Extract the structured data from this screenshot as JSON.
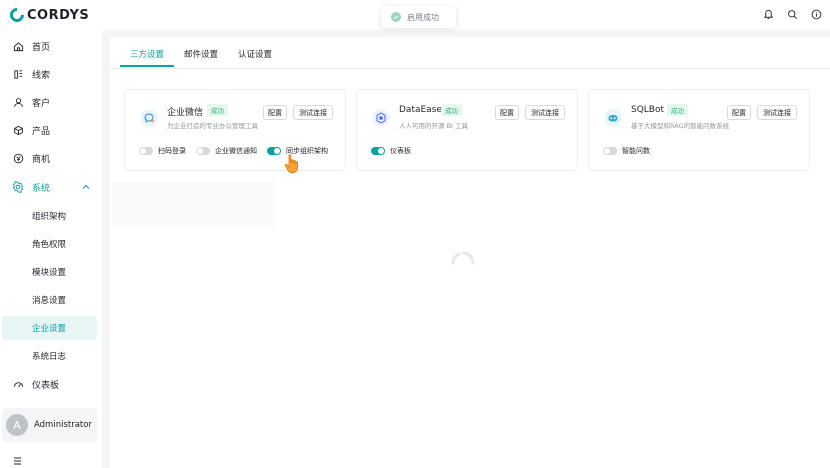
{
  "brand": {
    "name": "CORDYS",
    "accent": "#0da0a0"
  },
  "toast": {
    "message": "启用成功",
    "icon": "success-check-icon"
  },
  "header": {
    "icons": [
      "bell-icon",
      "search-icon",
      "info-icon"
    ]
  },
  "sidebar": {
    "items": [
      {
        "label": "首页",
        "icon": "home-icon"
      },
      {
        "label": "线索",
        "icon": "leads-icon"
      },
      {
        "label": "客户",
        "icon": "customer-icon"
      },
      {
        "label": "产品",
        "icon": "box-icon"
      },
      {
        "label": "商机",
        "icon": "opportunity-icon"
      },
      {
        "label": "系统",
        "icon": "settings-icon"
      },
      {
        "label": "仪表板",
        "icon": "dashboard-icon"
      }
    ],
    "system_sub": [
      "组织架构",
      "角色权限",
      "模块设置",
      "消息设置",
      "企业设置",
      "系统日志"
    ],
    "active_sub": "企业设置",
    "user": {
      "avatar_letter": "A",
      "name": "Administrator"
    }
  },
  "tabs": [
    "三方设置",
    "邮件设置",
    "认证设置"
  ],
  "active_tab": "三方设置",
  "cards": [
    {
      "title": "企业微信",
      "badge": "成功",
      "desc": "为企业打造的专业办公管理工具",
      "config_label": "配置",
      "test_label": "测试连接",
      "icon": "wecom-icon",
      "toggles": [
        {
          "label": "扫码登录",
          "on": false
        },
        {
          "label": "企业微信通知",
          "on": false
        },
        {
          "label": "同步组织架构",
          "on": true
        }
      ]
    },
    {
      "title": "DataEase",
      "badge": "成功",
      "desc": "人人可用的开源 BI 工具",
      "config_label": "配置",
      "test_label": "测试连接",
      "icon": "dataease-icon",
      "toggles": [
        {
          "label": "仪表板",
          "on": true
        }
      ]
    },
    {
      "title": "SQLBot",
      "badge": "成功",
      "desc": "基于大模型和RAG的智能问数系统",
      "config_label": "配置",
      "test_label": "测试连接",
      "icon": "sqlbot-icon",
      "toggles": [
        {
          "label": "智能问数",
          "on": false
        }
      ]
    }
  ]
}
